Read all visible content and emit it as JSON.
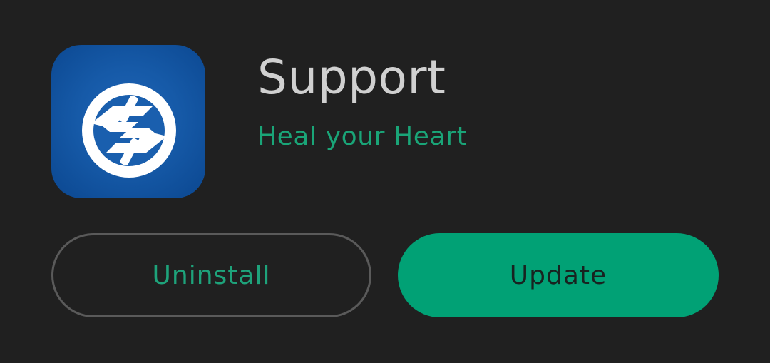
{
  "app": {
    "title": "Support",
    "subtitle": "Heal your Heart",
    "icon": "support-hands-logo-icon"
  },
  "actions": {
    "uninstall_label": "Uninstall",
    "update_label": "Update"
  },
  "colors": {
    "background": "#202020",
    "accent": "#01a175",
    "accent_text": "#1ea37b",
    "title_text": "#d0d0d0",
    "icon_background": "#165aa8"
  }
}
